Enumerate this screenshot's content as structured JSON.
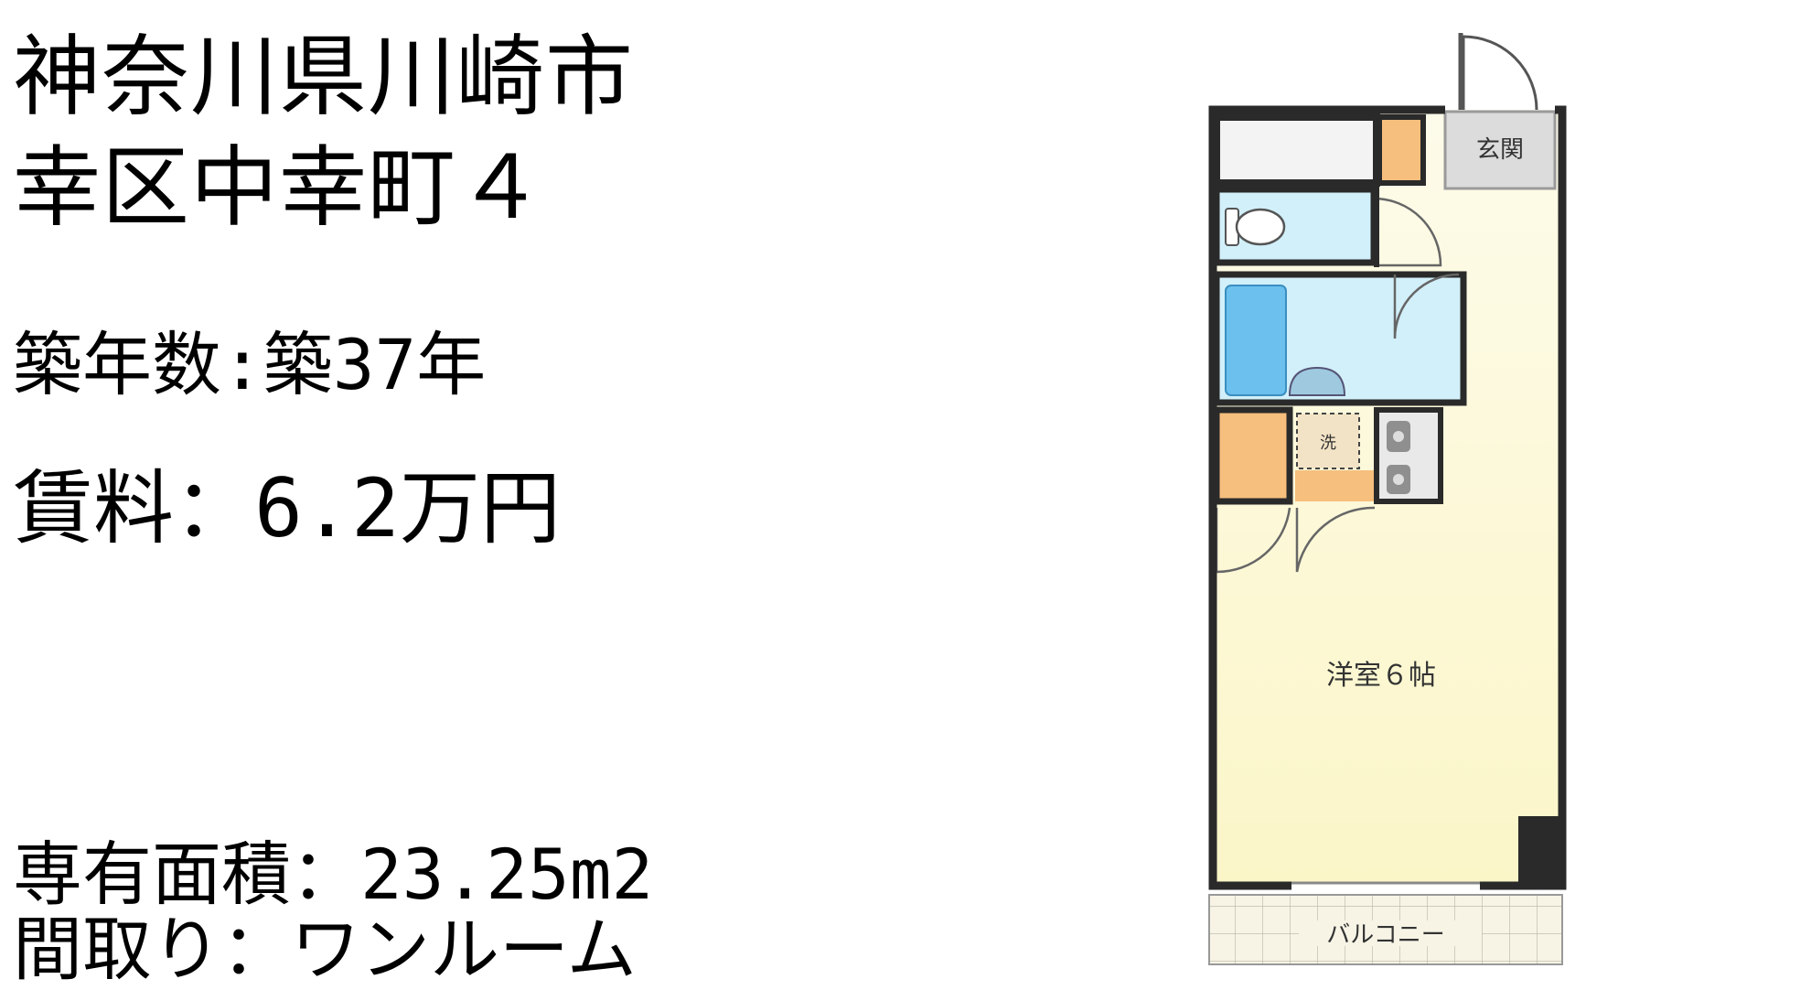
{
  "listing": {
    "address_line1": "神奈川県川崎市",
    "address_line2": "幸区中幸町４",
    "building_age": "築年数:築37年",
    "rent": "賃料：6.2万円",
    "area": "専有面積：23.25m2",
    "layout": "間取り：ワンルーム"
  },
  "floorplan": {
    "entrance_label": "玄関",
    "laundry_label": "洗",
    "room_label": "洋室６帖",
    "balcony_label": "バルコニー"
  },
  "colors": {
    "wall": "#2a2a2a",
    "room_floor": "#fbf8dc",
    "wet_area": "#d2f0fa",
    "storage": "#f6bf7d",
    "entrance": "#dcdcdc",
    "bathtub": "#6cc0ee"
  }
}
